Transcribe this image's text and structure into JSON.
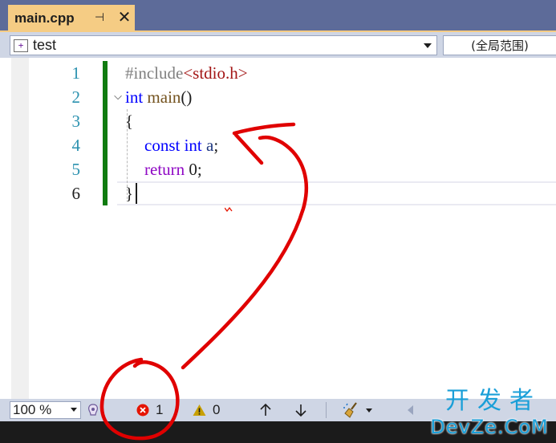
{
  "tab": {
    "title": "main.cpp",
    "pin_glyph": "⊣",
    "close_glyph": "✕"
  },
  "navbar": {
    "project": "test",
    "scope": "(全局范围)"
  },
  "editor": {
    "line_numbers": [
      "1",
      "2",
      "3",
      "4",
      "5",
      "6"
    ],
    "lines": {
      "l1": {
        "pp": "#include",
        "inc": "<stdio.h>"
      },
      "l2": {
        "kw": "int",
        "fn": "main",
        "rest": "()"
      },
      "l3": {
        "text": "{"
      },
      "l4": {
        "kw1": "const",
        "kw2": "int",
        "var": "a",
        "rest": ";"
      },
      "l5": {
        "kw": "return",
        "rest": " 0;"
      },
      "l6": {
        "text": "}"
      }
    },
    "collapse_glyph": "⌵"
  },
  "statusbar": {
    "zoom": "100 %",
    "errors": "1",
    "warnings": "0"
  },
  "watermark": {
    "top": "开发者",
    "bottom": "DevZe.CoM"
  },
  "colors": {
    "tab_active": "#f5cc84",
    "frame": "#5d6b99",
    "change_bar": "#107c10",
    "line_number": "#2b91af",
    "keyword": "#0000ff",
    "error": "#e51400",
    "warning": "#c8a000",
    "annotation": "#e00000"
  }
}
